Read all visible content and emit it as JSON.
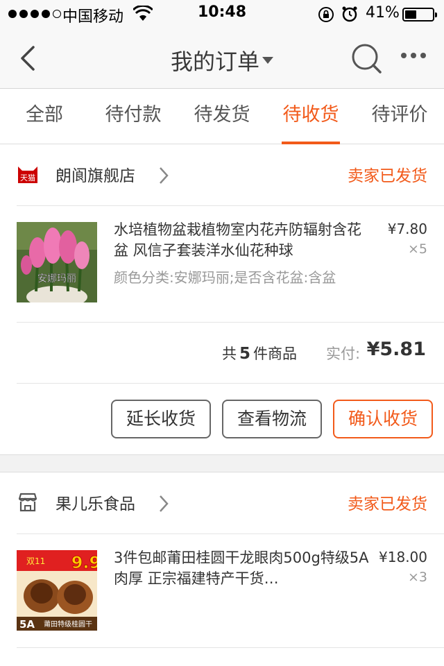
{
  "status_bar": {
    "carrier": "中国移动",
    "time": "10:48",
    "battery_percent": "41%",
    "battery_level": 0.41,
    "icons": [
      "signal-dots-icon",
      "wifi-icon",
      "rotation-lock-icon",
      "alarm-icon",
      "battery-icon"
    ]
  },
  "nav": {
    "title": "我的订单",
    "icons": [
      "back-arrow-icon",
      "dropdown-caret-icon",
      "search-icon",
      "more-icon"
    ]
  },
  "tabs": [
    {
      "label": "全部",
      "active": false
    },
    {
      "label": "待付款",
      "active": false
    },
    {
      "label": "待发货",
      "active": false
    },
    {
      "label": "待收货",
      "active": true
    },
    {
      "label": "待评价",
      "active": false
    }
  ],
  "accent_color": "#f25a1a",
  "orders": [
    {
      "shop_name": "朗阆旗舰店",
      "shop_icon": "tmall-icon",
      "shop_icon_text": "天猫",
      "status": "卖家已发货",
      "item": {
        "title": "水培植物盆栽植物室内花卉防辐射含花盆 风信子套装洋水仙花种球",
        "sku": "颜色分类:安娜玛丽;是否含花盆:含盆",
        "price": "¥7.80",
        "qty": "×5",
        "image_caption": "安娜玛丽"
      },
      "summary": {
        "count_prefix": "共",
        "count": "5",
        "count_suffix": "件商品",
        "paid_label": "实付:",
        "paid_amount": "¥5.81"
      },
      "actions": [
        "延长收货",
        "查看物流",
        "确认收货"
      ]
    },
    {
      "shop_name": "果儿乐食品",
      "shop_icon": "store-icon",
      "status": "卖家已发货",
      "item": {
        "title": "3件包邮莆田桂圆干龙眼肉500g特级5A肉厚 正宗福建特产干货…",
        "price": "¥18.00",
        "qty": "×3",
        "image_badge": "5A",
        "image_caption": "莆田特级桂圆干",
        "image_price": "9.9",
        "image_tag": "双11"
      }
    }
  ]
}
